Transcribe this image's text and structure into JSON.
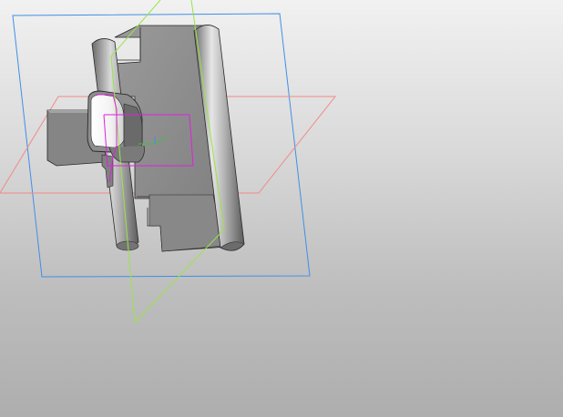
{
  "viewport": {
    "background_top": "#f1f1f1",
    "background_bottom": "#aeaeae"
  },
  "planes": [
    {
      "name": "frontal-plane",
      "color": "#3f8fe6"
    },
    {
      "name": "horizontal-plane",
      "color": "#f08a8a"
    },
    {
      "name": "profile-plane",
      "color": "#9ae44a"
    }
  ],
  "sketch": {
    "color": "#e020e0"
  },
  "model": {
    "body_color": "#8d8d8d",
    "shadow_color": "#5c5c5c",
    "highlight_color": "#ededed",
    "edge_color": "#2a2a2a"
  }
}
